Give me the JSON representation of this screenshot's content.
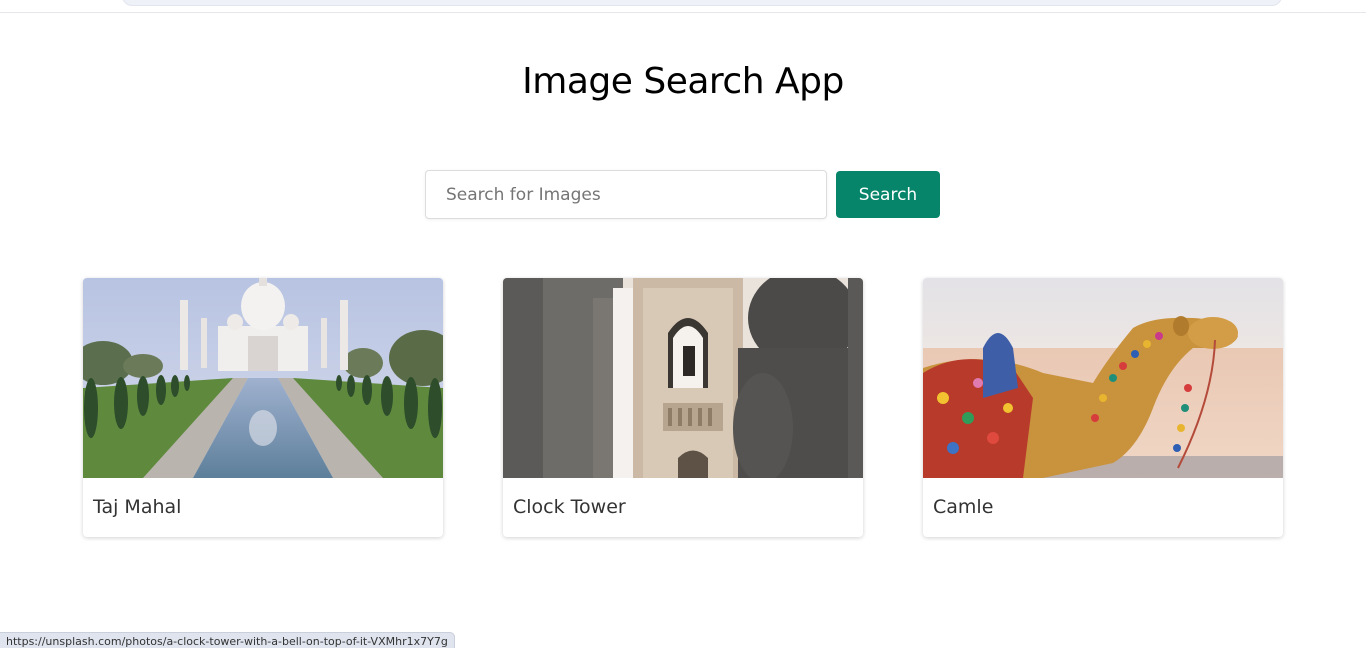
{
  "page": {
    "title": "Image Search App"
  },
  "search": {
    "placeholder": "Search for Images",
    "value": "",
    "button_label": "Search",
    "button_color": "#06856a"
  },
  "results": [
    {
      "caption": "Taj Mahal",
      "image": "taj-mahal-photo"
    },
    {
      "caption": "Clock Tower",
      "image": "clock-tower-photo"
    },
    {
      "caption": "Camle",
      "image": "camel-photo"
    }
  ],
  "status_bar": {
    "url": "https://unsplash.com/photos/a-clock-tower-with-a-bell-on-top-of-it-VXMhr1x7Y7g"
  }
}
